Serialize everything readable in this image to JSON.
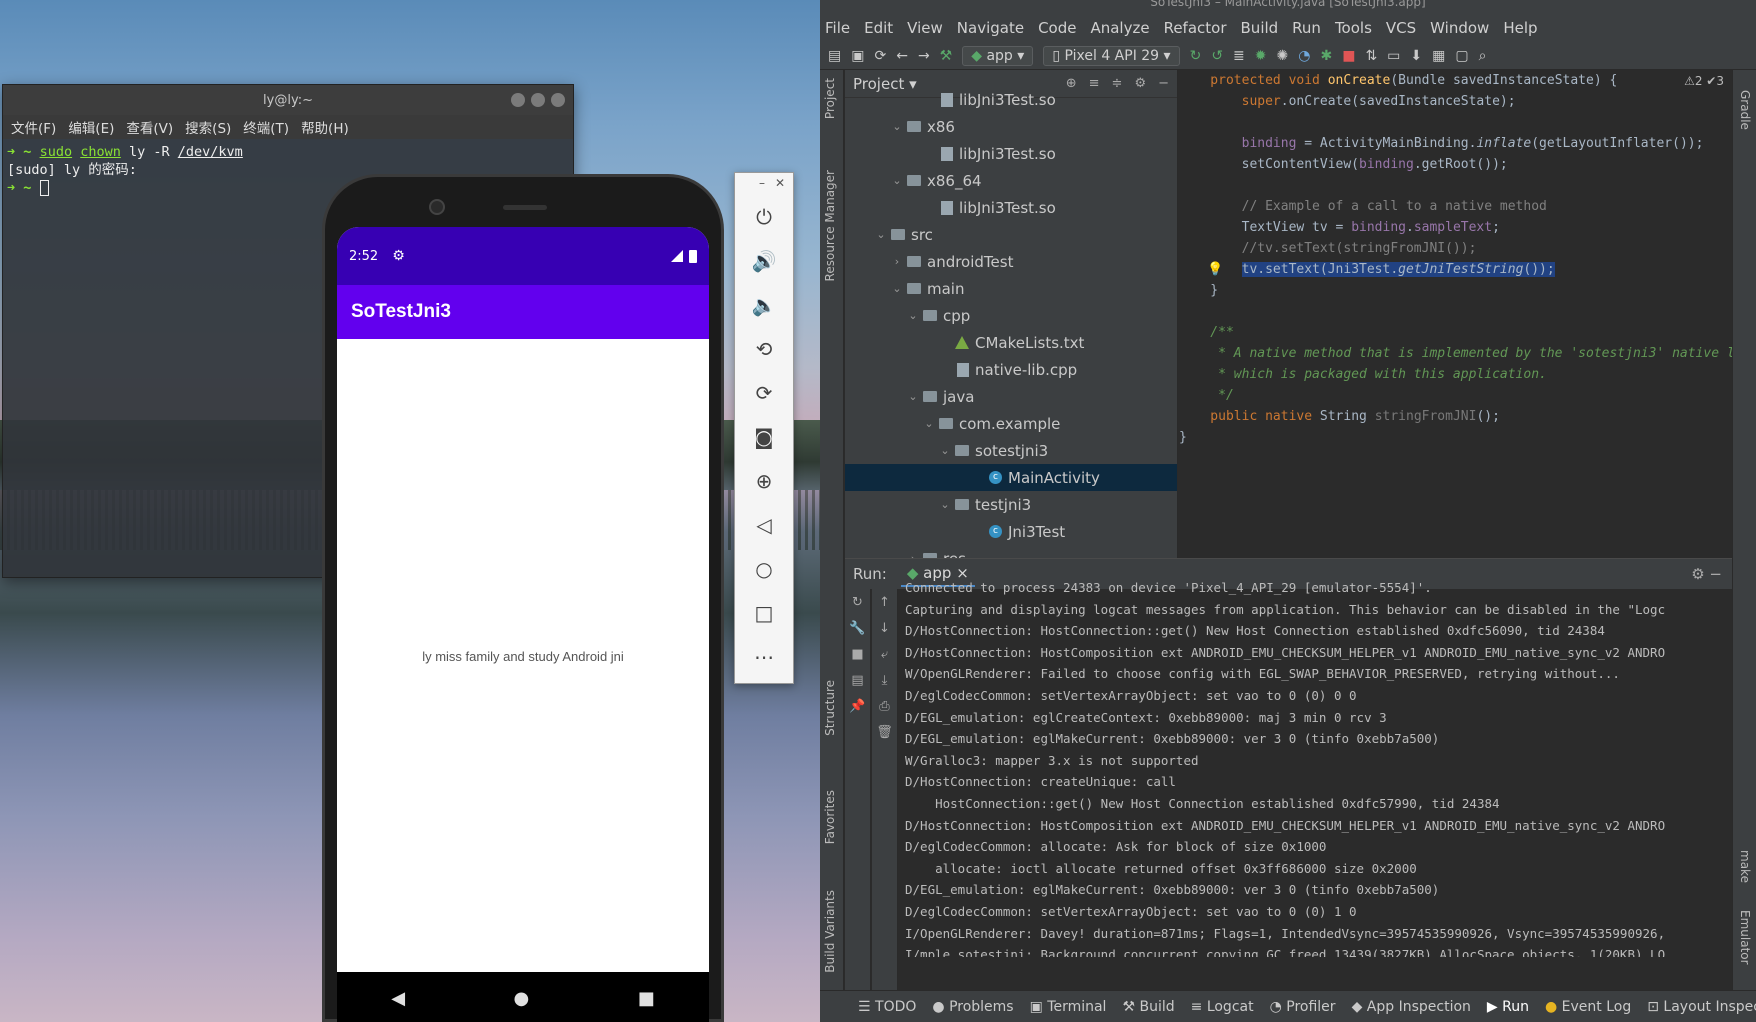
{
  "terminal": {
    "title": "ly@ly:~",
    "menu": [
      "文件(F)",
      "编辑(E)",
      "查看(V)",
      "搜索(S)",
      "终端(T)",
      "帮助(H)"
    ],
    "line1": {
      "prompt": "➜",
      "dir": "~",
      "cmd": "sudo",
      "cmd2": "chown",
      "args": "ly -R",
      "path": "/dev/kvm"
    },
    "line2": "[sudo] ly 的密码:",
    "line3": {
      "prompt": "➜",
      "dir": "~"
    }
  },
  "phone": {
    "time": "2:52",
    "app_title": "SoTestJni3",
    "sample_text": "ly miss family and study Android jni"
  },
  "studio": {
    "title": "SoTestJni3 – MainActivity.java [SoTestJni3.app]",
    "menu": [
      "File",
      "Edit",
      "View",
      "Navigate",
      "Code",
      "Analyze",
      "Refactor",
      "Build",
      "Run",
      "Tools",
      "VCS",
      "Window",
      "Help"
    ],
    "toolbar": {
      "config": "app",
      "device": "Pixel 4 API 29"
    },
    "project_header": "Project",
    "tree": [
      {
        "label": "libJni3Test.so",
        "depth": 5,
        "type": "file",
        "twisty": ""
      },
      {
        "label": "x86",
        "depth": 3,
        "type": "folder",
        "twisty": "⌄"
      },
      {
        "label": "libJni3Test.so",
        "depth": 5,
        "type": "file",
        "twisty": ""
      },
      {
        "label": "x86_64",
        "depth": 3,
        "type": "folder",
        "twisty": "⌄"
      },
      {
        "label": "libJni3Test.so",
        "depth": 5,
        "type": "file",
        "twisty": ""
      },
      {
        "label": "src",
        "depth": 2,
        "type": "folder",
        "twisty": "⌄"
      },
      {
        "label": "androidTest",
        "depth": 3,
        "type": "folder",
        "twisty": "›"
      },
      {
        "label": "main",
        "depth": 3,
        "type": "folder",
        "twisty": "⌄"
      },
      {
        "label": "cpp",
        "depth": 4,
        "type": "folder",
        "twisty": "⌄"
      },
      {
        "label": "CMakeLists.txt",
        "depth": 6,
        "type": "cmake",
        "twisty": ""
      },
      {
        "label": "native-lib.cpp",
        "depth": 6,
        "type": "file",
        "twisty": ""
      },
      {
        "label": "java",
        "depth": 4,
        "type": "folder",
        "twisty": "⌄"
      },
      {
        "label": "com.example",
        "depth": 5,
        "type": "folder",
        "twisty": "⌄"
      },
      {
        "label": "sotestjni3",
        "depth": 6,
        "type": "folder",
        "twisty": "⌄"
      },
      {
        "label": "MainActivity",
        "depth": 8,
        "type": "class",
        "twisty": "",
        "selected": true
      },
      {
        "label": "testjni3",
        "depth": 6,
        "type": "folder",
        "twisty": "⌄"
      },
      {
        "label": "Jni3Test",
        "depth": 8,
        "type": "class",
        "twisty": ""
      },
      {
        "label": "res",
        "depth": 4,
        "type": "folder",
        "twisty": "›"
      }
    ],
    "inspections": "⚠2 ✔3",
    "run": {
      "label": "Run:",
      "tab": "app",
      "log": [
        "Connected to process 24383 on device 'Pixel_4_API_29 [emulator-5554]'.",
        "Capturing and displaying logcat messages from application. This behavior can be disabled in the \"Logc",
        "D/HostConnection: HostConnection::get() New Host Connection established 0xdfc56090, tid 24384",
        "D/HostConnection: HostComposition ext ANDROID_EMU_CHECKSUM_HELPER_v1 ANDROID_EMU_native_sync_v2 ANDRO",
        "W/OpenGLRenderer: Failed to choose config with EGL_SWAP_BEHAVIOR_PRESERVED, retrying without...",
        "D/eglCodecCommon: setVertexArrayObject: set vao to 0 (0) 0 0",
        "D/EGL_emulation: eglCreateContext: 0xebb89000: maj 3 min 0 rcv 3",
        "D/EGL_emulation: eglMakeCurrent: 0xebb89000: ver 3 0 (tinfo 0xebb7a500)",
        "W/Gralloc3: mapper 3.x is not supported",
        "D/HostConnection: createUnique: call",
        "    HostConnection::get() New Host Connection established 0xdfc57990, tid 24384",
        "D/HostConnection: HostComposition ext ANDROID_EMU_CHECKSUM_HELPER_v1 ANDROID_EMU_native_sync_v2 ANDRO",
        "D/eglCodecCommon: allocate: Ask for block of size 0x1000",
        "    allocate: ioctl allocate returned offset 0x3ff686000 size 0x2000",
        "D/EGL_emulation: eglMakeCurrent: 0xebb89000: ver 3 0 (tinfo 0xebb7a500)",
        "D/eglCodecCommon: setVertexArrayObject: set vao to 0 (0) 1 0",
        "I/OpenGLRenderer: Davey! duration=871ms; Flags=1, IntendedVsync=39574535990926, Vsync=39574535990926,",
        "I/mple.sotestjni: Background concurrent copying GC freed 13439(3827KB) AllocSpace objects, 1(20KB) LO"
      ]
    },
    "bottom_tabs": [
      "TODO",
      "Problems",
      "Terminal",
      "Build",
      "Logcat",
      "Profiler",
      "App Inspection",
      "Run",
      "Event Log",
      "Layout Inspec"
    ],
    "left_stripe": [
      "Project",
      "Resource Manager",
      "Structure",
      "Favorites",
      "Build Variants"
    ],
    "right_stripe": [
      "Gradle",
      "make",
      "Emulator"
    ]
  }
}
